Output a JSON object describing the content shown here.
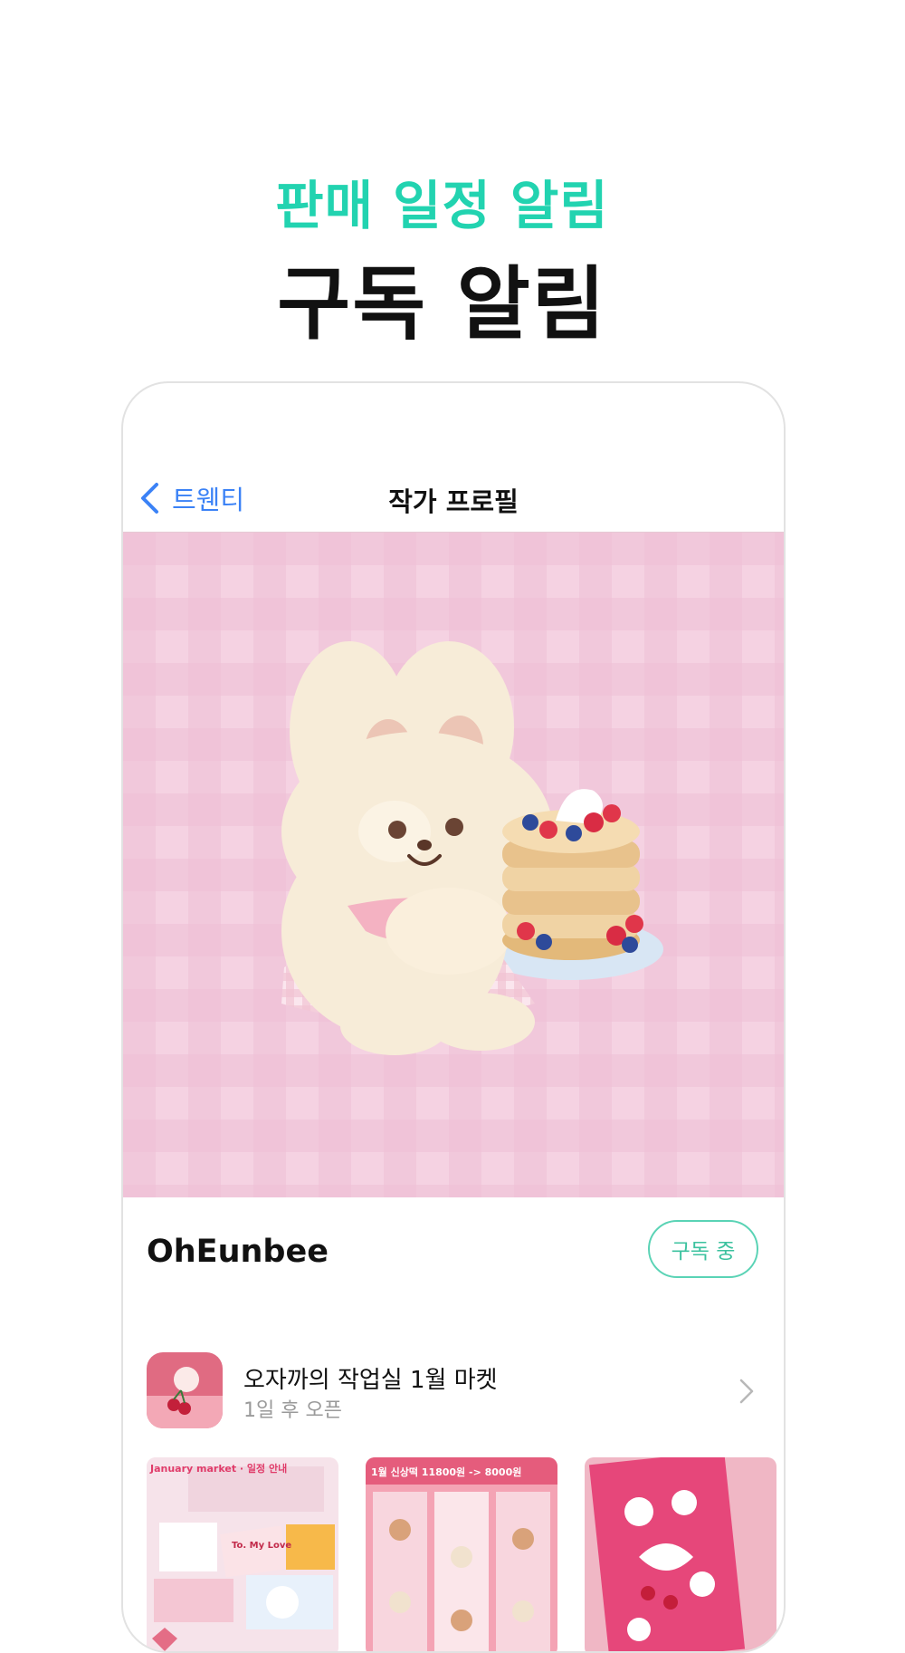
{
  "headline": {
    "subtitle": "판매 일정 알림",
    "title": "구독 알림"
  },
  "nav": {
    "back_label": "트웬티",
    "title": "작가 프로필"
  },
  "artist": {
    "name": "OhEunbee",
    "subscribe_label": "구독 중"
  },
  "market": {
    "title": "오자까의 작업실 1월 마켓",
    "subtitle": "1일 후 오픈"
  },
  "products": [
    {
      "tag": "January market · 일정 안내",
      "note": "To. My Love"
    },
    {
      "tag": "1월 신상떡 11800원 -> 8000원"
    },
    {
      "tag": ""
    }
  ],
  "colors": {
    "accent_teal": "#22d3b0",
    "back_blue": "#3b82f6",
    "subscribe_green": "#3cc29f",
    "banner_pink": "#f3c9dc"
  },
  "icons": {
    "back": "chevron-left-icon",
    "market_arrow": "chevron-right-icon"
  }
}
